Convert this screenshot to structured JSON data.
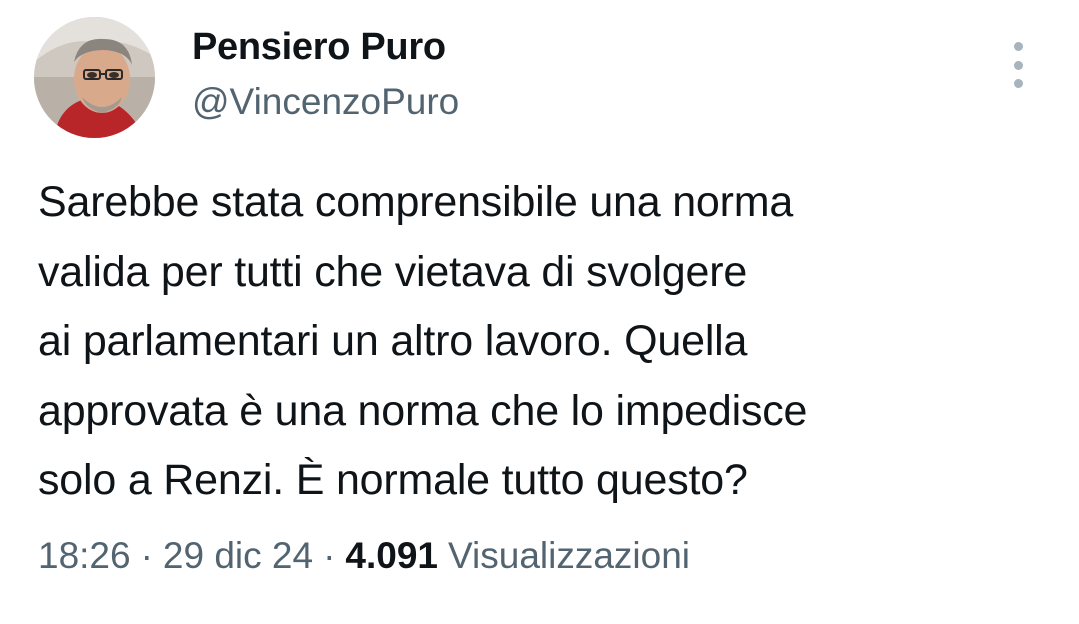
{
  "user": {
    "display_name": "Pensiero Puro",
    "handle": "@VincenzoPuro"
  },
  "tweet": {
    "lines": [
      "Sarebbe stata comprensibile una norma",
      "valida per tutti che vietava di svolgere",
      "ai parlamentari un altro lavoro. Quella",
      "approvata è una norma che lo impedisce",
      "solo a Renzi. È normale tutto questo?"
    ]
  },
  "meta": {
    "time": "18:26",
    "separator": "·",
    "date": "29 dic 24",
    "views_count": "4.091",
    "views_label": "Visualizzazioni"
  },
  "icons": {
    "more": "more-vertical-icon"
  },
  "colors": {
    "text_primary": "#0f1419",
    "text_secondary": "#536471",
    "more_icon": "#a7b4bd"
  }
}
